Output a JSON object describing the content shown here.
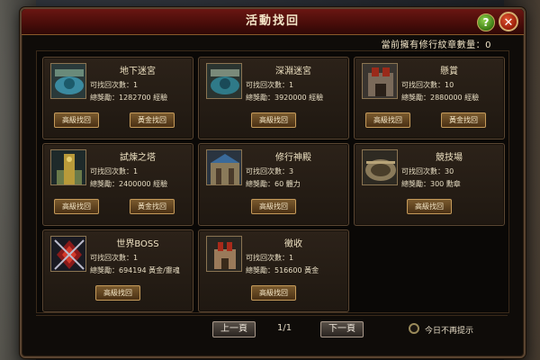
{
  "window": {
    "title": "活動找回",
    "medals_label": "當前擁有修行紋章數量：",
    "medals_value": "0"
  },
  "activities": [
    {
      "name": "地下迷宮",
      "count_label": "可找回次數：",
      "count": "1",
      "reward_label": "總獎勵：",
      "reward": "1282700 經驗",
      "buttons": [
        "高級找回",
        "黃金找回"
      ],
      "thumb": "dungeon-maze-thumb"
    },
    {
      "name": "深淵迷宮",
      "count_label": "可找回次數：",
      "count": "1",
      "reward_label": "總獎勵：",
      "reward": "3920000 經驗",
      "buttons": [
        "高級找回"
      ],
      "thumb": "abyss-maze-thumb"
    },
    {
      "name": "懸賞",
      "count_label": "可找回次數：",
      "count": "10",
      "reward_label": "總獎勵：",
      "reward": "2880000 經驗",
      "buttons": [
        "高級找回",
        "黃金找回"
      ],
      "thumb": "bounty-thumb"
    },
    {
      "name": "試煉之塔",
      "count_label": "可找回次數：",
      "count": "1",
      "reward_label": "總獎勵：",
      "reward": "2400000 經驗",
      "buttons": [
        "高級找回",
        "黃金找回"
      ],
      "thumb": "trial-tower-thumb"
    },
    {
      "name": "修行神殿",
      "count_label": "可找回次數：",
      "count": "3",
      "reward_label": "總獎勵：",
      "reward": "60 體力",
      "buttons": [
        "高級找回"
      ],
      "thumb": "practice-temple-thumb"
    },
    {
      "name": "競技場",
      "count_label": "可找回次數：",
      "count": "30",
      "reward_label": "總獎勵：",
      "reward": "300 勳章",
      "buttons": [
        "高級找回"
      ],
      "thumb": "arena-thumb"
    },
    {
      "name": "世界BOSS",
      "count_label": "可找回次數：",
      "count": "1",
      "reward_label": "總獎勵：",
      "reward": "694194 黃金/靈魂",
      "buttons": [
        "高級找回"
      ],
      "thumb": "world-boss-thumb"
    },
    {
      "name": "徵收",
      "count_label": "可找回次數：",
      "count": "1",
      "reward_label": "總獎勵：",
      "reward": "516600 黃金",
      "buttons": [
        "高級找回"
      ],
      "thumb": "levy-thumb"
    }
  ],
  "footer": {
    "prev": "上一頁",
    "page": "1/1",
    "next": "下一頁",
    "dont_show": "今日不再提示"
  },
  "colors": {
    "title_bar": "#6a1612",
    "panel_bg": "#2c2219",
    "button_gold": "#7a5a2e",
    "text": "#efe2c2"
  }
}
